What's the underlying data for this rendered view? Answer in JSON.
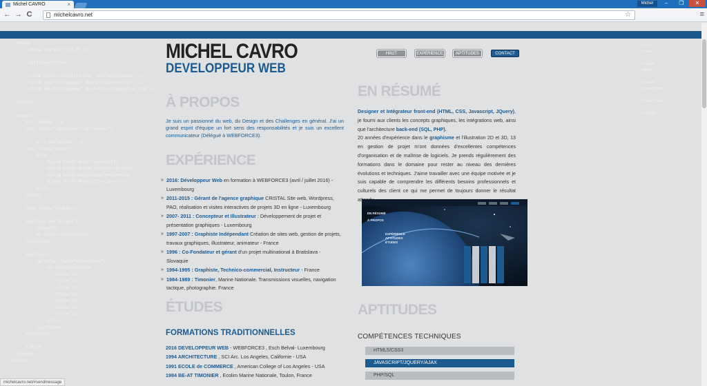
{
  "browser": {
    "tab_title": "Michel CAVRO",
    "tab_close": "×",
    "url": "michelcavro.net",
    "profile_name": "Michel",
    "min_glyph": "–",
    "max_glyph": "❐",
    "close_glyph": "✕",
    "back_glyph": "←",
    "forward_glyph": "→",
    "reload_glyph": "C",
    "star_glyph": "☆",
    "menu_glyph": "≡",
    "status_url": "michelcavro.net/#sendmessage"
  },
  "brand": {
    "name": "MICHEL CAVRO",
    "role": "DEVELOPPEUR WEB"
  },
  "nav": [
    {
      "label": "HAUT",
      "active": false
    },
    {
      "label": "EXPÉRIENCE",
      "active": false
    },
    {
      "label": "APTITUDES",
      "active": false
    },
    {
      "label": "CONTACT",
      "active": true
    }
  ],
  "sections": {
    "about": "À PROPOS",
    "experience": "EXPÉRIENCE",
    "education": "ÉTUDES",
    "summary": "EN RÉSUMÉ",
    "skills": "APTITUDES"
  },
  "about_text": "Je suis un passionné du web, du Design et des Challenges en général. J'ai un grand esprit d'équipe un fort sens des responsabilités et je suis un excellent communicateur (Délégué à WEBFORCE3).",
  "experience": [
    {
      "title": "2016: Développeur Web",
      "text": " en formation à WEBFORCE3 (avril / juillet 2016) - Luxembourg"
    },
    {
      "title": "2011-2015 : Gérant de l'agence graphique",
      "text": " CRISTAL Site web, Wordpress, PAO, réalisation et visites interactives de projets 3D en ligne - Luxembourg"
    },
    {
      "title": "2007- 2011 : Concepteur et Illustrateur",
      "text": " : Développement de projet et présentation graphiques - Luxembourg"
    },
    {
      "title": "1997-2007 : Graphiste Indépendant",
      "text": " Création de sites web, gestion de projets, travaux graphiques, illustrateur, animateur - France"
    },
    {
      "title": "1996 : Co-Fondateur et gérant",
      "text": " d'un projet multinational à Bratislava - Slovaquie"
    },
    {
      "title": "1994-1995 : Graphiste, Technico-commercial, Instructeur",
      "text": " - France"
    },
    {
      "title": "1984-1989 : Timonier",
      "text": ", Marine Nationale. Transmissions visuelles, navigation tactique, photographie. France"
    }
  ],
  "formations_title": "FORMATIONS TRADITIONNELLES",
  "education": [
    {
      "title": "2016 DEVELOPPEUR WEB",
      "text": " - WEBFORCE3 , Esch Belval- Luxembourg"
    },
    {
      "title": "1994 ARCHITECTURE",
      "text": " , SCI Arc. Los Angeles, Californie - USA"
    },
    {
      "title": "1991 ECOLE de COMMERCE",
      "text": " , American College of Los Angeles - USA"
    },
    {
      "title": "1984 BE-AT TIMONIER",
      "text": " , Ecolim Marine Nationale, Toulon, France"
    }
  ],
  "summary": {
    "lead": "Designer et Intégrateur front-end (HTML, CSS, Javascript, JQuery)",
    "p1": ", je fourni aux clients les concepts graphiques, les intégrations web, ainsi que l'architecture ",
    "backend": "back-end (SQL, PHP)",
    "p1_end": ".",
    "p2a": "20 années d'expérience dans le ",
    "graphisme": "graphisme",
    "p2b": " et l'illustration 2D et 3D, 13 en gestion de projet m'ont données d'excellentes compétences d'organisation et de maîtrise de logiciels. Je prends régulièrement des formations dans le domaine pour rester au niveau des dernières évolutions et techniques. J'aime travailler avec une équipe motivée et je suis capable de comprendre les différents besoins professionnels et culturels des client ce qui me permet de toujours donner le résultat attendu."
  },
  "preview": {
    "title": "EN RÉSUMÉ",
    "line2": "À PROPOS",
    "line3": "EXPÉRIENCE",
    "line4": "APTITUDES",
    "line5": "ÉTUDES"
  },
  "skills_title": "COMPÉTENCES TECHNIQUES",
  "skills": [
    {
      "label": "HTML5/CSS3",
      "active": false
    },
    {
      "label": "JAVASCRIPT/JQUERY/AJAX",
      "active": true
    },
    {
      "label": "PHP/SQL",
      "active": false
    }
  ],
  "colors": {
    "brand_blue": "#1d5a90",
    "page_bg": "#dfe1e3",
    "heading_grey": "#c3c5c8"
  }
}
